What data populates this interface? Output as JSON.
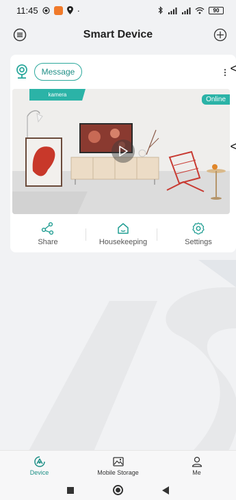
{
  "status_bar": {
    "time": "11:45",
    "battery": "90",
    "dot": "·"
  },
  "header": {
    "title": "Smart Device"
  },
  "device_card": {
    "message_label": "Message",
    "device_name": "kamera",
    "status": "Online",
    "stray_marks": [
      "<",
      "<"
    ],
    "actions": [
      {
        "label": "Share",
        "icon": "share-icon"
      },
      {
        "label": "Housekeeping",
        "icon": "home-icon"
      },
      {
        "label": "Settings",
        "icon": "gear-icon"
      }
    ]
  },
  "tabs": [
    {
      "label": "Device",
      "icon": "device-icon",
      "active": true
    },
    {
      "label": "Mobile Storage",
      "icon": "image-icon",
      "active": false
    },
    {
      "label": "Me",
      "icon": "user-icon",
      "active": false
    }
  ],
  "colors": {
    "accent": "#2bb3a7",
    "accent_text": "#1d8f86",
    "background": "#f1f2f4"
  }
}
